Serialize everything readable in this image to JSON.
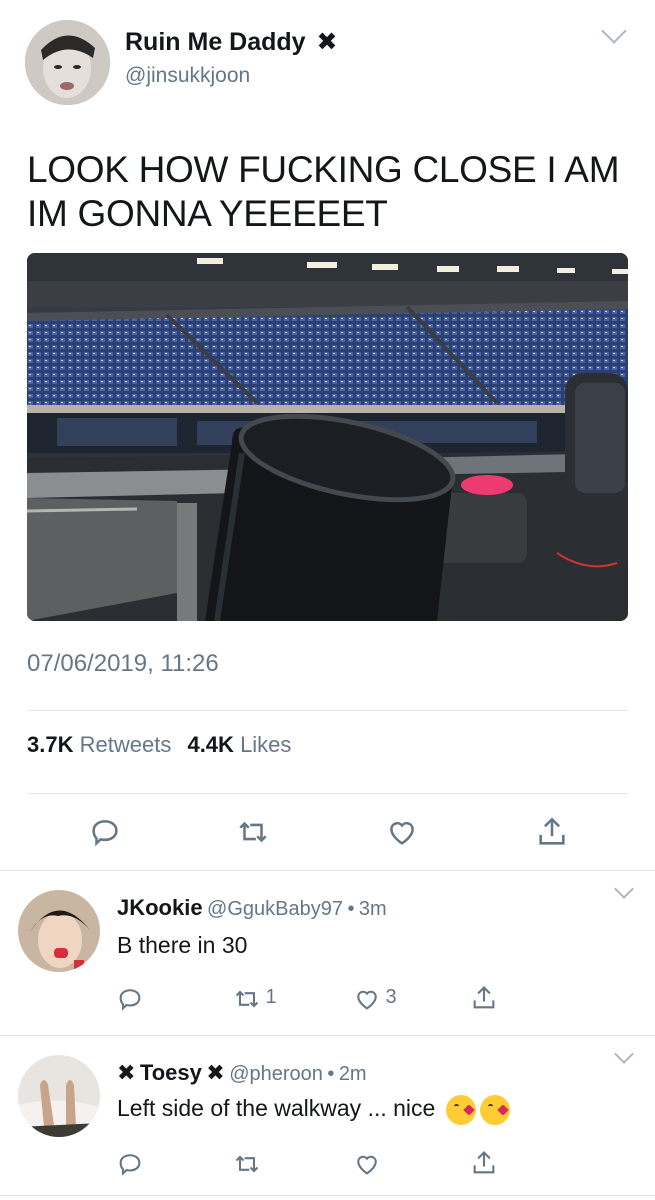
{
  "tweet": {
    "author_name": "Ruin Me Daddy",
    "author_badge": "✖",
    "author_handle": "@jinsukkjoon",
    "text_line1": "LOOK HOW FUCKING CLOSE I AM",
    "text_line2": "IM GONNA YEEEEET",
    "timestamp": "07/06/2019, 11:26",
    "retweets_count": "3.7K",
    "retweets_label": "Retweets",
    "likes_count": "4.4K",
    "likes_label": "Likes"
  },
  "replies": [
    {
      "name": "JKookie",
      "handle": "@GgukBaby97",
      "separator": "•",
      "time": "3m",
      "text": "B there in 30",
      "retweet_count": "1",
      "like_count": "3"
    },
    {
      "name_prefix": "✖",
      "name": "Toesy",
      "name_suffix": "✖",
      "handle": "@pheroon",
      "separator": "•",
      "time": "2m",
      "text": "Left side of the walkway ... nice",
      "retweet_count": "",
      "like_count": ""
    }
  ],
  "colors": {
    "text_primary": "#14171a",
    "text_muted": "#657786",
    "divider": "#e1e8ed",
    "icon": "#657786"
  }
}
